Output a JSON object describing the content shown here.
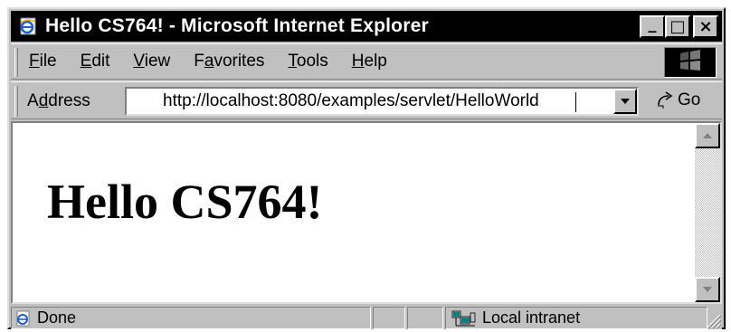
{
  "window": {
    "title": "Hello CS764! - Microsoft Internet Explorer",
    "minimize_glyph": "_",
    "maximize_glyph": "□",
    "close_glyph": "×"
  },
  "menu": {
    "items": [
      {
        "label_ul": "F",
        "label_rest": "ile"
      },
      {
        "label_ul": "E",
        "label_rest": "dit"
      },
      {
        "label_ul": "V",
        "label_rest": "iew"
      },
      {
        "label_pre": "F",
        "label_ul": "a",
        "label_rest": "vorites"
      },
      {
        "label_ul": "T",
        "label_rest": "ools"
      },
      {
        "label_ul": "H",
        "label_rest": "elp"
      }
    ]
  },
  "address": {
    "label_pre": "A",
    "label_ul": "d",
    "label_rest": "dress",
    "url": "http://localhost:8080/examples/servlet/HelloWorld",
    "go_label": "Go"
  },
  "page": {
    "heading": "Hello CS764!"
  },
  "status": {
    "text": "Done",
    "zone": "Local intranet"
  },
  "icons": {
    "title": "ie-page-icon",
    "throbber": "windows-logo-icon",
    "go": "go-arrow-icon",
    "status": "ie-page-icon",
    "zone": "local-intranet-icon"
  }
}
